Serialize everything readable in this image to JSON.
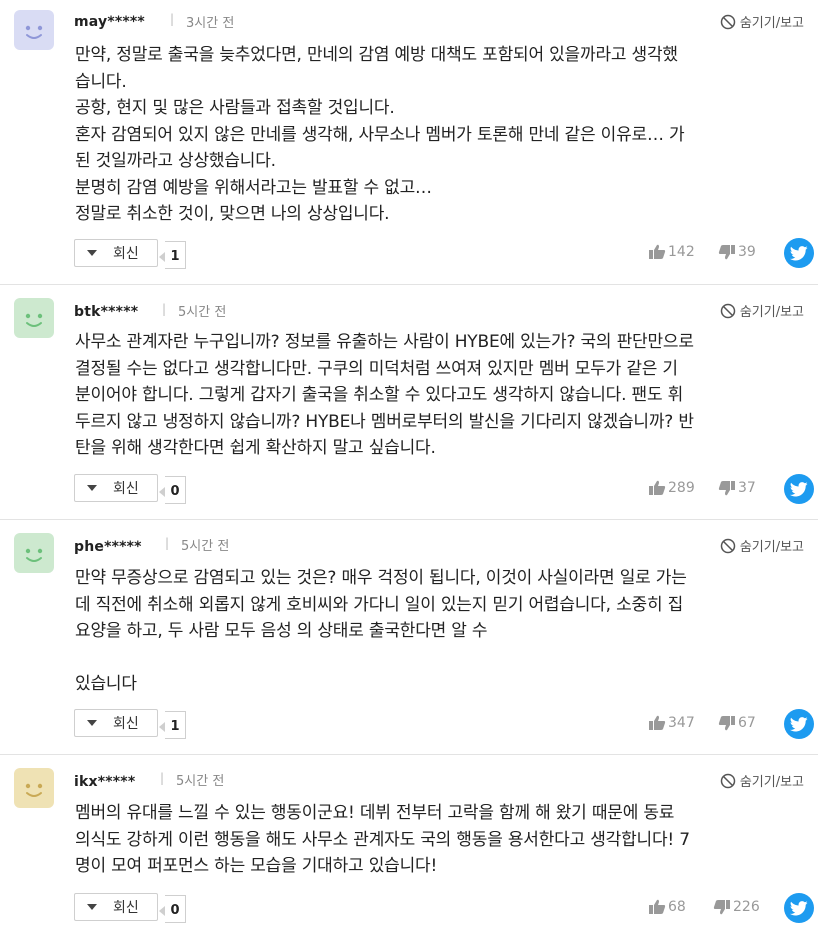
{
  "colors": {
    "avatar_purple": "#d9dcf4",
    "avatar_green": "#cde9cf",
    "avatar_yellow": "#efe2b4",
    "face_purple": "#8f97d8",
    "face_green": "#6cc07b",
    "face_yellow": "#c9a955",
    "twitter": "#1d9bf0"
  },
  "hide_label": "숨기기/보고",
  "reply_label": "회신",
  "comments": [
    {
      "user": "may*****",
      "time": "3시간 전",
      "avatar": "purple",
      "lines": [
        "만약, 정말로 출국을 늦추었다면, 만네의 감염 예방 대책도 포함되어 있을까라고 생각했",
        "습니다.",
        "공항, 현지 및 많은 사람들과 접촉할 것입니다.",
        "혼자 감염되어 있지 않은 만네를 생각해, 사무소나 멤버가 토론해 만네 같은 이유로… 가",
        "된 것일까라고 상상했습니다.",
        "분명히 감염 예방을 위해서라고는 발표할 수 없고…",
        "정말로 취소한 것이, 맞으면 나의 상상입니다."
      ],
      "replies": "1",
      "likes": "142",
      "dislikes": "39"
    },
    {
      "user": "btk*****",
      "time": "5시간 전",
      "avatar": "green",
      "lines": [
        "사무소 관계자란 누구입니까? 정보를 유출하는 사람이 HYBE에 있는가? 국의 판단만으로",
        "결정될 수는 없다고 생각합니다만. 구쿠의 미덕처럼 쓰여져 있지만 멤버 모두가 같은 기",
        "분이어야 합니다. 그렇게 갑자기 출국을 취소할 수 있다고도 생각하지 않습니다. 팬도 휘",
        "두르지 않고 냉정하지 않습니까? HYBE나 멤버로부터의 발신을 기다리지 않겠습니까? 반",
        "탄을 위해 생각한다면 쉽게 확산하지 말고 싶습니다."
      ],
      "replies": "0",
      "likes": "289",
      "dislikes": "37"
    },
    {
      "user": "phe*****",
      "time": "5시간 전",
      "avatar": "green",
      "lines": [
        "만약 무증상으로 감염되고 있는 것은? 매우 걱정이 됩니다, 이것이 사실이라면 일로 가는",
        "데 직전에 취소해 외롭지 않게 호비씨와 가다니 일이 있는지 믿기 어렵습니다, 소중히 집",
        "요양을 하고, 두 사람 모두 음성 의 상태로 출국한다면 알 수",
        "",
        "있습니다"
      ],
      "replies": "1",
      "likes": "347",
      "dislikes": "67"
    },
    {
      "user": "ikx*****",
      "time": "5시간 전",
      "avatar": "yellow",
      "lines": [
        "멤버의 유대를 느낄 수 있는 행동이군요! 데뷔 전부터 고락을 함께 해 왔기 때문에 동료",
        "의식도 강하게 이런 행동을 해도 사무소 관계자도 국의 행동을 용서한다고 생각합니다! 7",
        "명이 모여 퍼포먼스 하는 모습을 기대하고 있습니다!"
      ],
      "replies": "0",
      "likes": "68",
      "dislikes": "226"
    }
  ]
}
